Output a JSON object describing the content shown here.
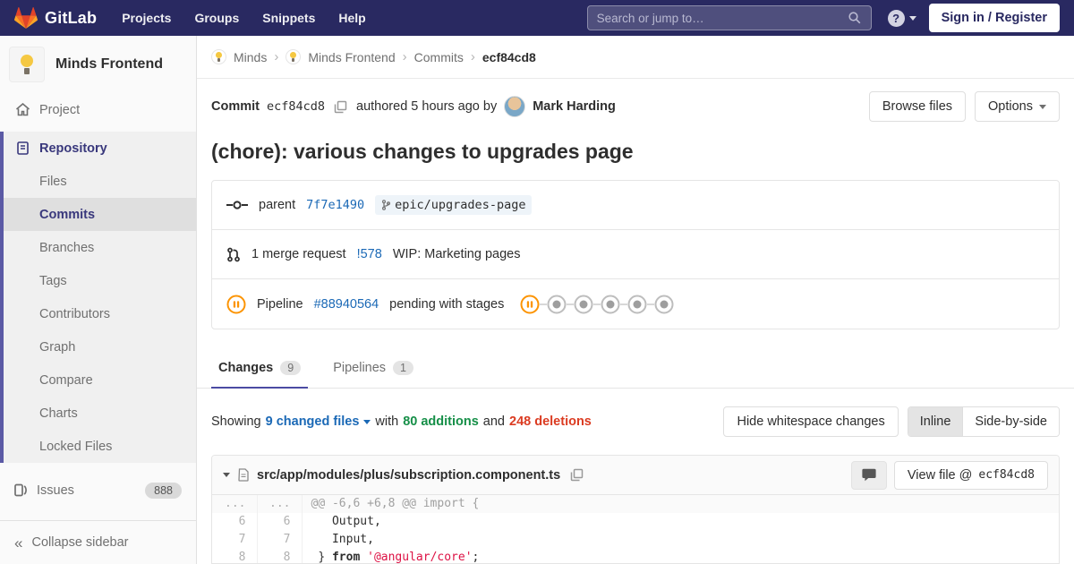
{
  "colors": {
    "navbar_bg": "#292961",
    "accent_indigo": "#4b4ba3",
    "link_blue": "#1b69b6",
    "addition_green": "#168f48",
    "deletion_red": "#db3b21",
    "pending_orange": "#fc9403"
  },
  "navbar": {
    "brand": "GitLab",
    "links": [
      "Projects",
      "Groups",
      "Snippets",
      "Help"
    ],
    "search_placeholder": "Search or jump to…",
    "signin_label": "Sign in / Register"
  },
  "sidebar": {
    "project_name": "Minds Frontend",
    "project_item": "Project",
    "repository_item": "Repository",
    "repo_subitems": [
      "Files",
      "Commits",
      "Branches",
      "Tags",
      "Contributors",
      "Graph",
      "Compare",
      "Charts",
      "Locked Files"
    ],
    "active_subitem": "Commits",
    "issues_label": "Issues",
    "issues_count": "888",
    "collapse_label": "Collapse sidebar"
  },
  "breadcrumb": {
    "items": [
      {
        "label": "Minds",
        "avatar": true
      },
      {
        "label": "Minds Frontend",
        "avatar": true
      },
      {
        "label": "Commits",
        "avatar": false
      }
    ],
    "current": "ecf84cd8",
    "separator": "›"
  },
  "commit": {
    "label": "Commit",
    "sha": "ecf84cd8",
    "authored_text": "authored 5 hours ago by",
    "author": "Mark Harding",
    "browse_files_label": "Browse files",
    "options_label": "Options",
    "title": "(chore): various changes to upgrades page",
    "parent_label": "parent",
    "parent_sha": "7f7e1490",
    "branch_name": "epic/upgrades-page",
    "mr_count_text": "1 merge request",
    "mr_ref": "!578",
    "mr_title": "WIP: Marketing pages",
    "pipeline_label": "Pipeline",
    "pipeline_id": "#88940564",
    "pipeline_status_text": "pending with stages",
    "pipeline_stages": [
      "pending",
      "created",
      "created",
      "created",
      "created",
      "created"
    ]
  },
  "tabs": [
    {
      "label": "Changes",
      "count": "9",
      "active": true
    },
    {
      "label": "Pipelines",
      "count": "1",
      "active": false
    }
  ],
  "summary": {
    "prefix": "Showing",
    "files_link": "9 changed files",
    "middle": "with",
    "additions": "80 additions",
    "conjunction": "and",
    "deletions": "248 deletions"
  },
  "controls": {
    "hide_whitespace_label": "Hide whitespace changes",
    "inline_label": "Inline",
    "side_by_side_label": "Side-by-side"
  },
  "diff": {
    "file_path": "src/app/modules/plus/subscription.component.ts",
    "view_file_label": "View file @",
    "view_file_sha": "ecf84cd8",
    "rows": [
      {
        "old": "...",
        "new": "...",
        "kind": "hunk",
        "segments": [
          {
            "text": "@@ -6,6 +6,8 @@ import {",
            "cls": "hunk"
          }
        ]
      },
      {
        "old": "6",
        "new": "6",
        "kind": "context",
        "segments": [
          {
            "text": "   Output,",
            "cls": "plain"
          }
        ]
      },
      {
        "old": "7",
        "new": "7",
        "kind": "context",
        "segments": [
          {
            "text": "   Input,",
            "cls": "plain"
          }
        ]
      },
      {
        "old": "8",
        "new": "8",
        "kind": "context",
        "segments": [
          {
            "text": " } ",
            "cls": "plain"
          },
          {
            "text": "from",
            "cls": "keyword"
          },
          {
            "text": " ",
            "cls": "plain"
          },
          {
            "text": "'@angular/core'",
            "cls": "string"
          },
          {
            "text": ";",
            "cls": "plain"
          }
        ]
      }
    ]
  },
  "icons": {
    "separator_glyph": "›",
    "collapse_glyph": "«",
    "help_glyph": "?"
  }
}
